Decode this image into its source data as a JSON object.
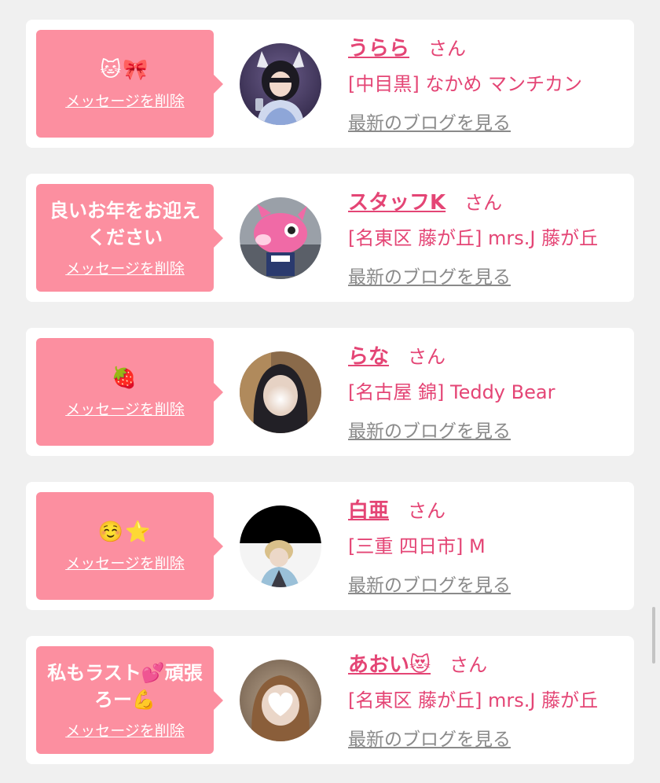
{
  "colors": {
    "background": "#f0f0f0",
    "card": "#ffffff",
    "bubble": "#fc8fa0",
    "accent": "#e44575",
    "muted": "#8a8a8a"
  },
  "messages": [
    {
      "text": "🐱🎀",
      "delete_label": "メッセージを削除",
      "name": "うらら",
      "honorific": "さん",
      "shop": "[中目黒] なかめ マンチカン",
      "blog_label": "最新のブログを見る",
      "avatar_icon": "avatar-photo"
    },
    {
      "text": "良いお年をお迎え\nください",
      "delete_label": "メッセージを削除",
      "name": "スタッフK",
      "honorific": "さん",
      "shop": "[名東区 藤が丘] mrs.J 藤が丘",
      "blog_label": "最新のブログを見る",
      "avatar_icon": "avatar-photo"
    },
    {
      "text": "🍓",
      "delete_label": "メッセージを削除",
      "name": "らな",
      "honorific": "さん",
      "shop": "[名古屋 錦] Teddy Bear",
      "blog_label": "最新のブログを見る",
      "avatar_icon": "avatar-photo"
    },
    {
      "text": "☺️⭐",
      "delete_label": "メッセージを削除",
      "name": "白亜",
      "honorific": "さん",
      "shop": "[三重 四日市] M",
      "blog_label": "最新のブログを見る",
      "avatar_icon": "avatar-photo"
    },
    {
      "text": "私もラスト💕頑張\nろー💪",
      "delete_label": "メッセージを削除",
      "name": "あおい😻",
      "honorific": "さん",
      "shop": "[名東区 藤が丘] mrs.J 藤が丘",
      "blog_label": "最新のブログを見る",
      "avatar_icon": "avatar-photo"
    }
  ]
}
